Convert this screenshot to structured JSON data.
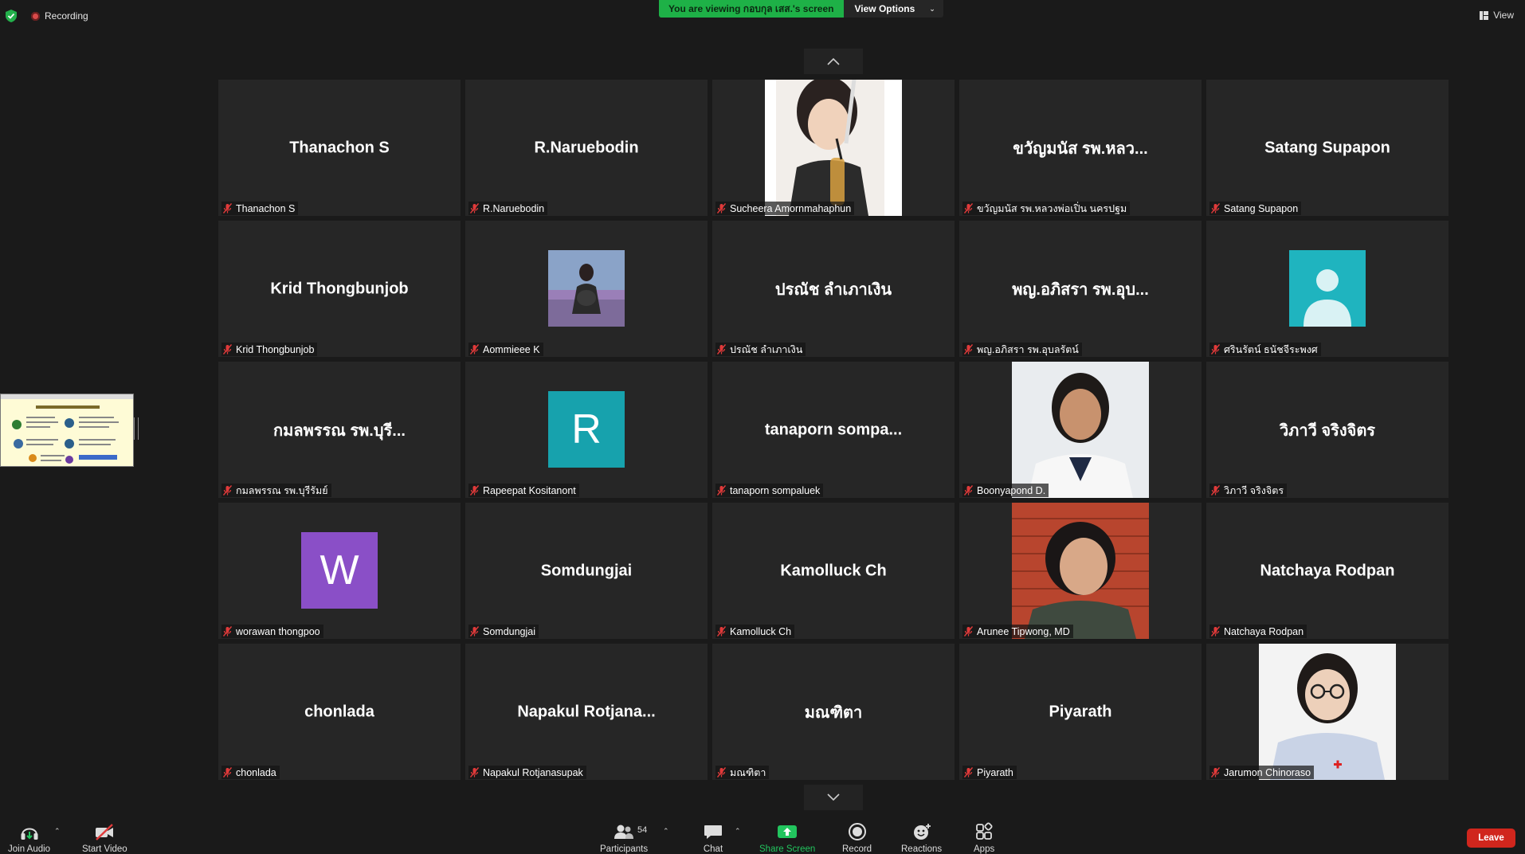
{
  "top_bar": {
    "recording_label": "Recording",
    "viewing_text": "You are viewing กอบกุล เสส.'s screen",
    "view_options_label": "View Options",
    "view_label": "View"
  },
  "gallery": {
    "tiles": [
      {
        "display": "Thanachon S",
        "caption": "Thanachon S"
      },
      {
        "display": "R.Naruebodin",
        "caption": "R.Naruebodin"
      },
      {
        "display": "",
        "caption": "Sucheera Amornmahaphun"
      },
      {
        "display": "ขวัญมนัส รพ.หลว...",
        "caption": "ขวัญมนัส รพ.หลวงพ่อเปิ่น นครปฐม"
      },
      {
        "display": "Satang Supapon",
        "caption": "Satang Supapon"
      },
      {
        "display": "Krid Thongbunjob",
        "caption": "Krid Thongbunjob"
      },
      {
        "display": "",
        "caption": "Aommieee K"
      },
      {
        "display": "ปรณัช ลำเภาเงิน",
        "caption": "ปรณัช ลำเภาเงิน"
      },
      {
        "display": "พญ.อภิสรา รพ.อุบ...",
        "caption": "พญ.อภิสรา รพ.อุบลรัตน์"
      },
      {
        "display": "",
        "caption": "ศรินรัตน์ ธนัชจีระพงศ"
      },
      {
        "display": "กมลพรรณ รพ.บุรี...",
        "caption": "กมลพรรณ รพ.บุรีรัมย์"
      },
      {
        "display": "R",
        "caption": "Rapeepat Kositanont"
      },
      {
        "display": "tanaporn sompa...",
        "caption": "tanaporn sompaluek"
      },
      {
        "display": "",
        "caption": "Boonyapond D."
      },
      {
        "display": "วิภาวี จริงจิตร",
        "caption": "วิภาวี จริงจิตร"
      },
      {
        "display": "W",
        "caption": "worawan thongpoo"
      },
      {
        "display": "Somdungjai",
        "caption": "Somdungjai"
      },
      {
        "display": "Kamolluck Ch",
        "caption": "Kamolluck Ch"
      },
      {
        "display": "",
        "caption": "Arunee Tipwong, MD"
      },
      {
        "display": "Natchaya Rodpan",
        "caption": "Natchaya Rodpan"
      },
      {
        "display": "chonlada",
        "caption": "chonlada"
      },
      {
        "display": "Napakul Rotjana...",
        "caption": "Napakul Rotjanasupak"
      },
      {
        "display": "มณฑิตา",
        "caption": "มณฑิตา"
      },
      {
        "display": "Piyarath",
        "caption": "Piyarath"
      },
      {
        "display": "",
        "caption": "Jarumon Chinoraso"
      }
    ]
  },
  "toolbar": {
    "join_audio": "Join Audio",
    "start_video": "Start Video",
    "participants": "Participants",
    "participants_count": "54",
    "chat": "Chat",
    "share_screen": "Share Screen",
    "record": "Record",
    "reactions": "Reactions",
    "apps": "Apps",
    "leave": "Leave"
  },
  "colors": {
    "banner_green": "#1eb147",
    "share_green": "#22c55e",
    "leave_red": "#d0261d",
    "avatar_teal": "#17a2ad",
    "avatar_purple": "#8a4fc7",
    "default_avatar_teal": "#1fb4bf"
  }
}
